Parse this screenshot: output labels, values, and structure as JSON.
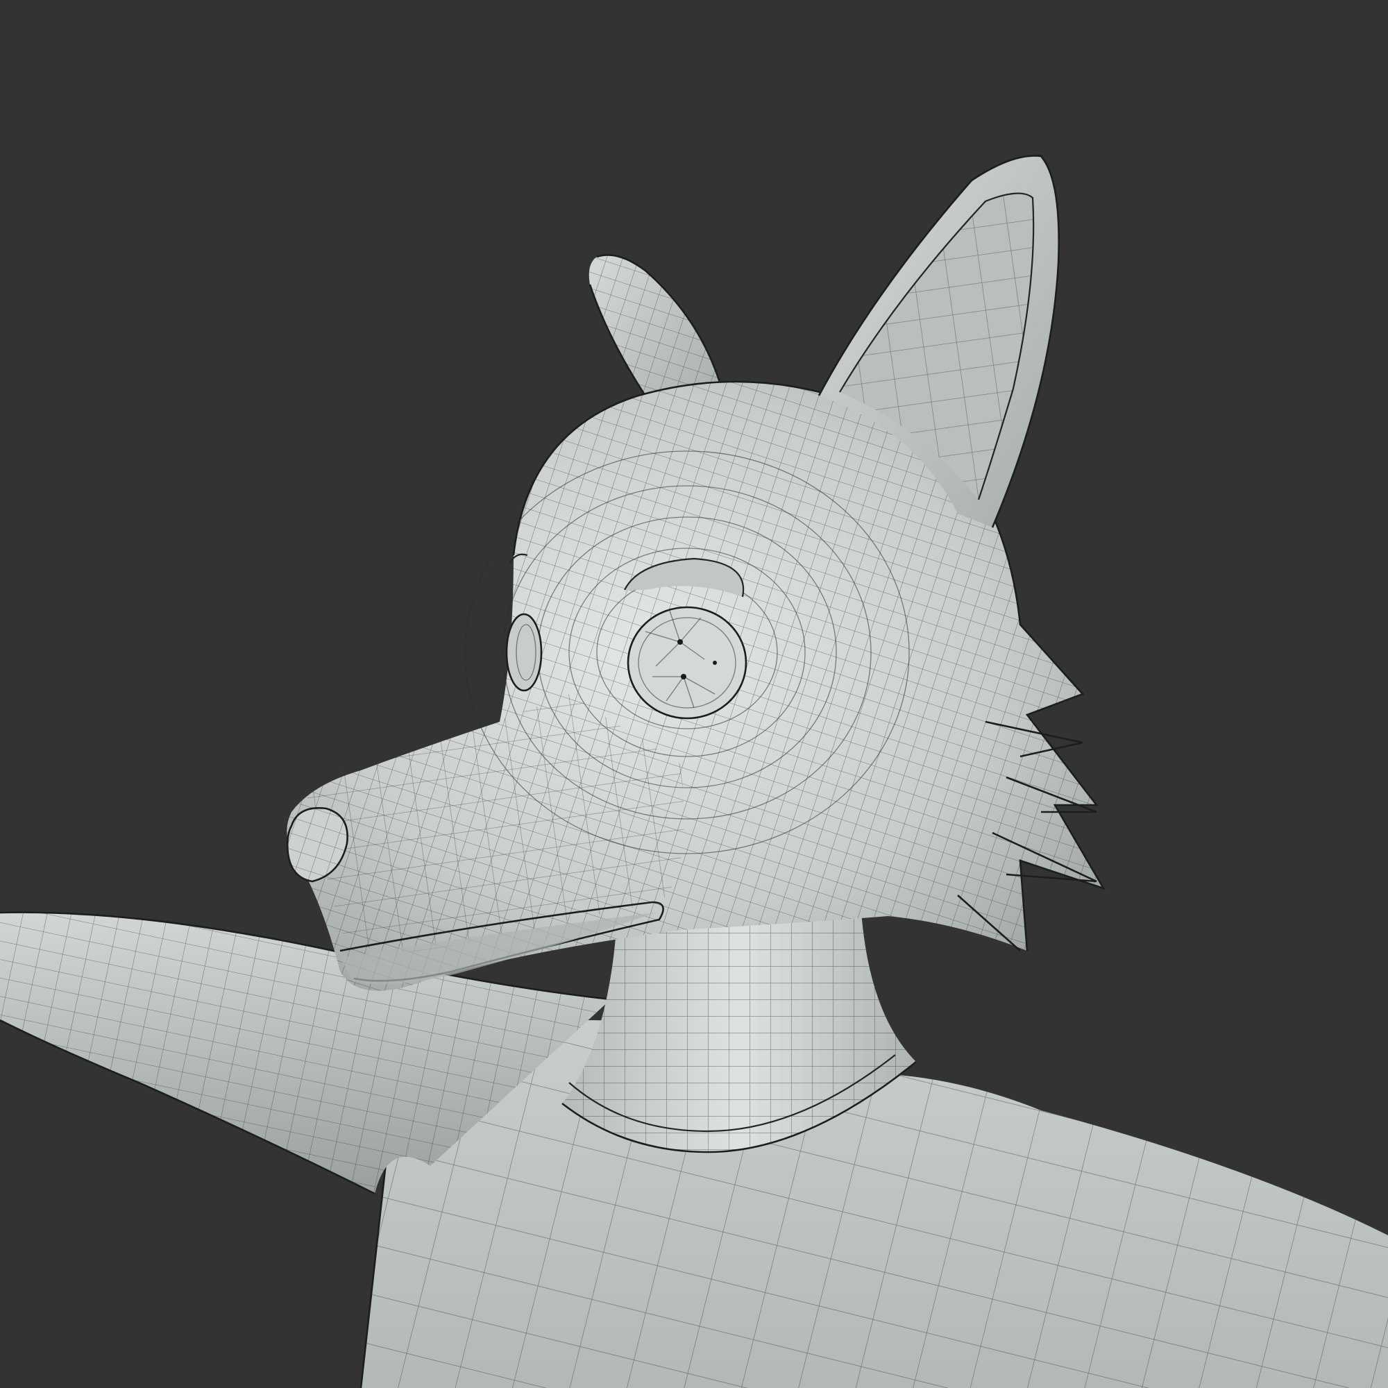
{
  "viewport": {
    "background_color": "#333333"
  },
  "model": {
    "subject": "stylized-fox-character-head-and-torso",
    "shading": "solid-gray-with-wireframe-overlay",
    "base_color": "#c4c8c8",
    "highlight_color": "#e2e5e5",
    "shadow_color": "#8f9494",
    "wire_color": "#2a2d2d"
  }
}
